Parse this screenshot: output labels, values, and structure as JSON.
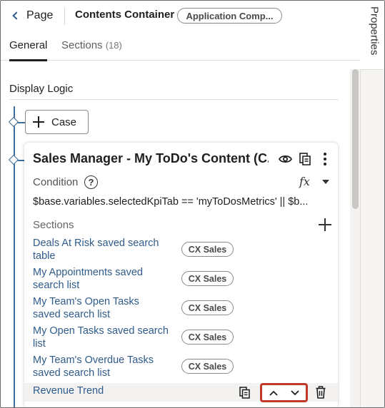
{
  "header": {
    "back_label": "Page",
    "title": "Contents Container",
    "app_pill": "Application Comp..."
  },
  "rail": {
    "label": "Properties"
  },
  "tabs": {
    "general": "General",
    "sections": "Sections",
    "sections_count": "(18)"
  },
  "display_logic": {
    "title": "Display Logic",
    "case_button": "Case"
  },
  "card": {
    "title": "Sales Manager - My ToDo's Content (C...",
    "condition_label": "Condition",
    "help_glyph": "?",
    "fx_glyph": "fx",
    "expression": "$base.variables.selectedKpiTab == 'myToDosMetrics' || $b...",
    "sections_label": "Sections",
    "sections": [
      {
        "label": "Deals At Risk saved search table",
        "badge": "CX Sales"
      },
      {
        "label": "My Appointments saved search list",
        "badge": "CX Sales"
      },
      {
        "label": "My Team's Open Tasks saved search list",
        "badge": "CX Sales"
      },
      {
        "label": "My Open Tasks saved search list",
        "badge": "CX Sales"
      },
      {
        "label": "My Team's Overdue Tasks saved search list",
        "badge": "CX Sales"
      }
    ],
    "selected_section": "Revenue Trend"
  },
  "colors": {
    "link": "#2f5b8a",
    "tree_line": "#3a6d9a",
    "highlight": "#c0392b"
  },
  "icons": [
    "chevron-left-icon",
    "eye-icon",
    "copy-icon",
    "kebab-icon",
    "help-icon",
    "fx-icon",
    "caret-down-icon",
    "plus-icon",
    "chevron-up-icon",
    "chevron-down-icon",
    "trash-icon"
  ]
}
